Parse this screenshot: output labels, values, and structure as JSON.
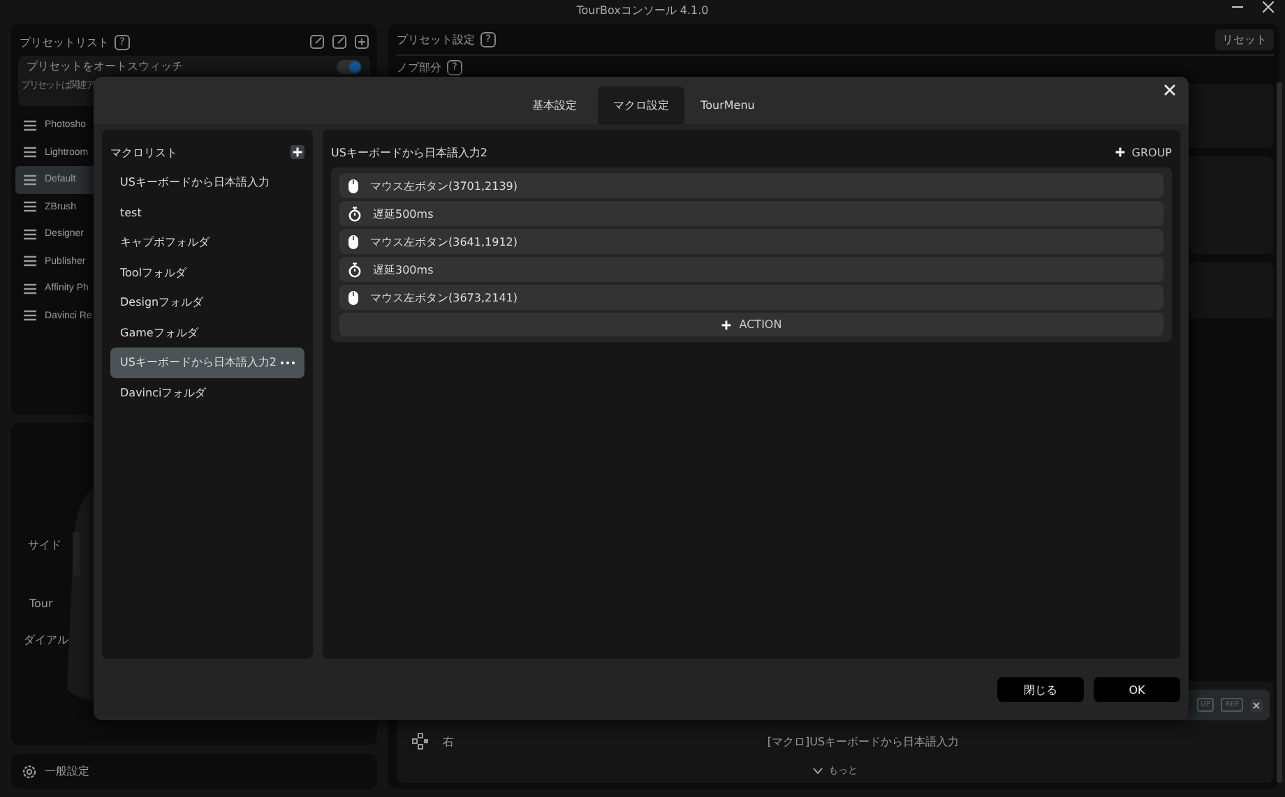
{
  "window": {
    "title": "TourBoxコンソール 4.1.0"
  },
  "preset_list": {
    "title": "プリセットリスト",
    "help": "?",
    "auto_switch": {
      "label": "プリセットをオートスウィッチ",
      "description": "プリセットは関連ア",
      "on": true
    },
    "items": [
      {
        "label": "Photosho",
        "selected": false
      },
      {
        "label": "Lightroom",
        "selected": false
      },
      {
        "label": "Default",
        "selected": true
      },
      {
        "label": "ZBrush",
        "selected": false
      },
      {
        "label": "Designer",
        "selected": false
      },
      {
        "label": "Publisher",
        "selected": false
      },
      {
        "label": "Affinity Ph",
        "selected": false
      },
      {
        "label": "Davinci Re",
        "selected": false
      }
    ]
  },
  "device": {
    "labels": [
      "サイド",
      "Tour",
      "ダイアル"
    ]
  },
  "general_settings": "一般設定",
  "preset_settings": {
    "title": "プリセット設定",
    "help": "?",
    "reset": "リセット",
    "section": "ノブ部分",
    "section_help": "?",
    "row_tools": [
      "UP",
      "REP"
    ],
    "assignment": {
      "button": "右",
      "action": "[マクロ]USキーボードから日本語入力"
    },
    "more": "もっと"
  },
  "dialog": {
    "tabs": [
      {
        "label": "基本設定",
        "selected": false
      },
      {
        "label": "マクロ設定",
        "selected": true
      },
      {
        "label": "TourMenu",
        "selected": false
      }
    ],
    "macro_list": {
      "title": "マクロリスト",
      "items": [
        {
          "label": "USキーボードから日本語入力",
          "selected": false
        },
        {
          "label": "test",
          "selected": false
        },
        {
          "label": "キャプボフォルダ",
          "selected": false
        },
        {
          "label": "Toolフォルダ",
          "selected": false
        },
        {
          "label": "Designフォルダ",
          "selected": false
        },
        {
          "label": "Gameフォルダ",
          "selected": false
        },
        {
          "label": "USキーボードから日本語入力2",
          "selected": true
        },
        {
          "label": "Davinciフォルダ",
          "selected": false
        }
      ]
    },
    "macro": {
      "title": "USキーボードから日本語入力2",
      "add_group": "GROUP",
      "actions": [
        {
          "kind": "mouse",
          "label": "マウス左ボタン(3701,2139)"
        },
        {
          "kind": "delay",
          "label": "遅延500ms"
        },
        {
          "kind": "mouse",
          "label": "マウス左ボタン(3641,1912)"
        },
        {
          "kind": "delay",
          "label": "遅延300ms"
        },
        {
          "kind": "mouse",
          "label": "マウス左ボタン(3673,2141)"
        }
      ],
      "add_action": "ACTION"
    },
    "buttons": [
      "閉じる",
      "OK"
    ]
  }
}
